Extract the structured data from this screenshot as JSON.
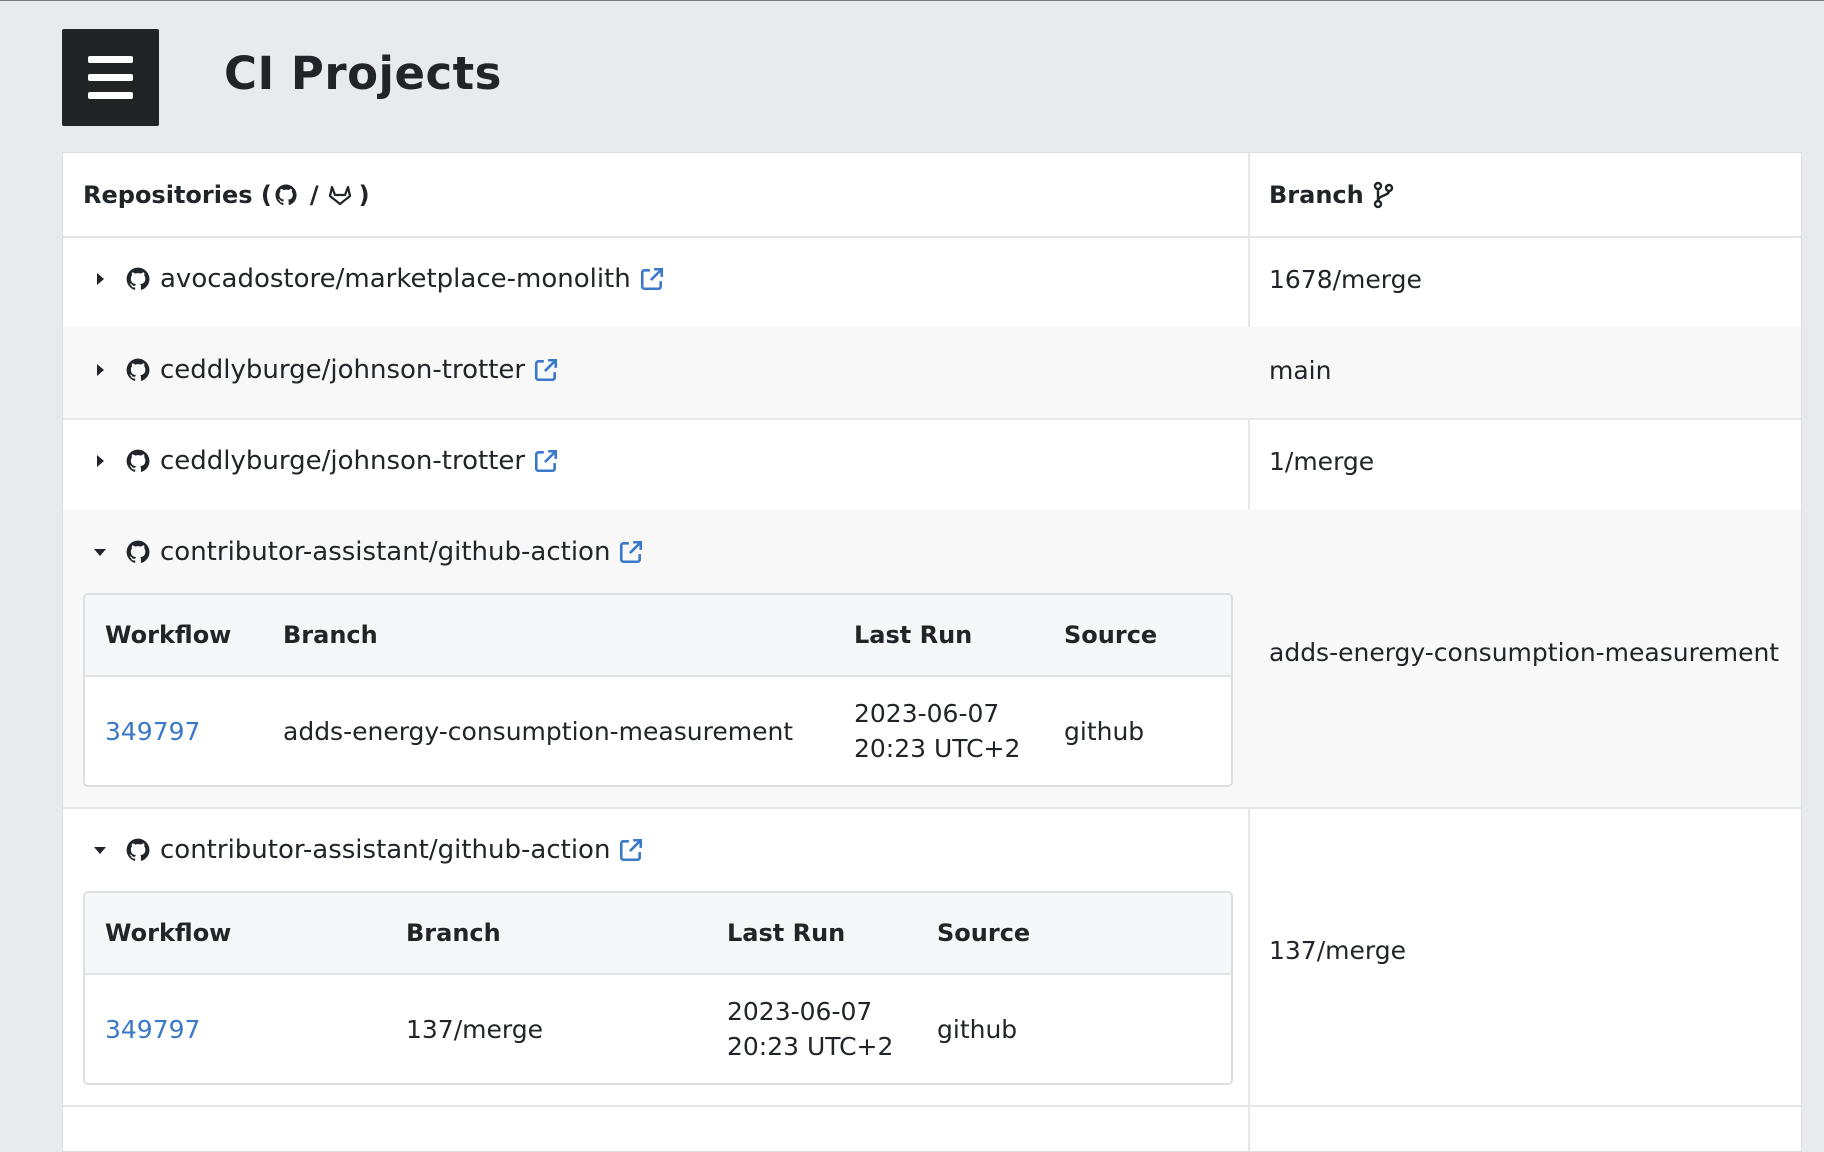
{
  "page": {
    "title": "CI Projects"
  },
  "table": {
    "repositories_header_prefix": "Repositories (",
    "repositories_header_sep": "/",
    "repositories_header_suffix": ")",
    "branch_header": "Branch"
  },
  "rows": [
    {
      "repo": "avocadostore/marketplace-monolith",
      "branch": "1678/merge",
      "expanded": false
    },
    {
      "repo": "ceddlyburge/johnson-trotter",
      "branch": "main",
      "expanded": false
    },
    {
      "repo": "ceddlyburge/johnson-trotter",
      "branch": "1/merge",
      "expanded": false
    },
    {
      "repo": "contributor-assistant/github-action",
      "branch": "adds-energy-consumption-measurement",
      "expanded": true,
      "details": {
        "headers": {
          "workflow": "Workflow",
          "branch": "Branch",
          "last_run": "Last Run",
          "source": "Source"
        },
        "workflow": "349797",
        "branch": "adds-energy-consumption-measurement",
        "last_run_date": "2023-06-07",
        "last_run_time": "20:23 UTC+2",
        "source": "github"
      }
    },
    {
      "repo": "contributor-assistant/github-action",
      "branch": "137/merge",
      "expanded": true,
      "details": {
        "headers": {
          "workflow": "Workflow",
          "branch": "Branch",
          "last_run": "Last Run",
          "source": "Source"
        },
        "workflow": "349797",
        "branch": "137/merge",
        "last_run_date": "2023-06-07",
        "last_run_time": "20:23 UTC+2",
        "source": "github"
      }
    }
  ],
  "colors": {
    "link": "#3a78c9",
    "menu_bg": "#222324",
    "page_bg": "#e9eaee"
  }
}
